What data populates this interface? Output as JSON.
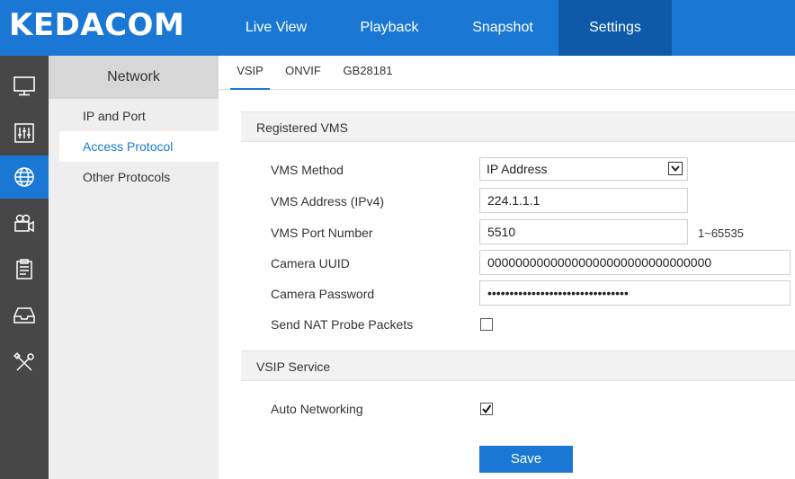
{
  "header": {
    "logo": "KEDACOM",
    "tabs": [
      {
        "label": "Live View"
      },
      {
        "label": "Playback"
      },
      {
        "label": "Snapshot"
      },
      {
        "label": "Settings",
        "active": true
      }
    ]
  },
  "sidebar_icons": [
    "monitor-icon",
    "equalizer-icon",
    "network-globe-icon",
    "camera-icon",
    "clipboard-icon",
    "storage-tray-icon",
    "tools-icon"
  ],
  "submenu": {
    "title": "Network",
    "items": [
      {
        "label": "IP and Port"
      },
      {
        "label": "Access Protocol",
        "active": true
      },
      {
        "label": "Other Protocols"
      }
    ]
  },
  "subtabs": [
    {
      "label": "VSIP",
      "active": true
    },
    {
      "label": "ONVIF"
    },
    {
      "label": "GB28181"
    }
  ],
  "registered_vms": {
    "section_title": "Registered VMS",
    "vms_method_label": "VMS Method",
    "vms_method_value": "IP Address",
    "vms_address_label": "VMS Address (IPv4)",
    "vms_address_value": "224.1.1.1",
    "vms_port_label": "VMS Port Number",
    "vms_port_value": "5510",
    "vms_port_range": "1~65535",
    "camera_uuid_label": "Camera UUID",
    "camera_uuid_value": "00000000000000000000000000000000",
    "camera_password_label": "Camera Password",
    "camera_password_value": "................................",
    "send_nat_label": "Send NAT Probe Packets",
    "send_nat_checked": false
  },
  "vsip_service": {
    "section_title": "VSIP Service",
    "auto_networking_label": "Auto Networking",
    "auto_networking_checked": true
  },
  "save_label": "Save",
  "colors": {
    "accent": "#1a78d4",
    "accent_dark": "#0e5aa8",
    "iconbar": "#474747",
    "submenu_bg": "#eeeeee"
  }
}
